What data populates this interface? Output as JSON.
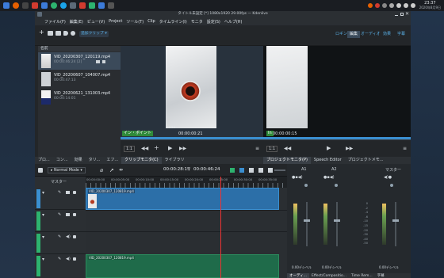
{
  "taskbar": {
    "clock_time": "23:37",
    "clock_date": "2020年8月9日",
    "app_icon_colors": [
      "#e66000",
      "#444444",
      "#d13b2f",
      "#3c7bd9",
      "#1aa3e8",
      "#d13b2f",
      "#2db36f"
    ]
  },
  "window": {
    "title": "タイトル未設定 [*] 1080x1920 29.00fps — Kdenlive"
  },
  "menu": [
    "ファイル(F)",
    "編集(E)",
    "ビュー(V)",
    "Project",
    "ツール(T)",
    "Clip",
    "タイムライン(I)",
    "モニタ",
    "設定(S)",
    "ヘルプ(H)"
  ],
  "toolbar": {
    "add_clip_label": "追加クリップ",
    "layouts": [
      "ロギング",
      "編集",
      "オーディオ",
      "効果",
      "字幕"
    ],
    "active_layout": "編集"
  },
  "bin": {
    "header": "名前",
    "clips": [
      {
        "name": "VID_20200307_120119.mp4",
        "duration": "00:00:46:24 [2]"
      },
      {
        "name": "VID_20200607_104007.mp4",
        "duration": "00:00:47:13"
      },
      {
        "name": "VID_20200621_131003.mp4",
        "duration": "00:00:14:01"
      }
    ]
  },
  "clip_monitor": {
    "in_point_label": "イン・ポイント",
    "timecode": "00:00:00:21",
    "vertical_timecode": "46:24"
  },
  "project_monitor": {
    "timecode": "00:00:00:15",
    "side_label": "In"
  },
  "monitor_controls": {
    "zoom_left": "1:1",
    "zoom_right": "1:1"
  },
  "tabs_left": [
    "プロ...",
    "コン...",
    "効果",
    "タリ...",
    "エフ...",
    "クリップモニタ(C)",
    "ライブラリ"
  ],
  "tabs_right": [
    "プロジェクトモニタ(P)",
    "Speech Editor",
    "プロジェクトメモ..."
  ],
  "timeline": {
    "mode": "Normal Mode",
    "position": "00:00:28:15",
    "duration": "00:00:46:24",
    "master_label": "マスター",
    "ruler_marks": [
      "00:00:00:00",
      "00:00:05:00",
      "00:00:10:00",
      "00:00:15:00",
      "00:00:20:00",
      "00:00:25:00",
      "00:00:30:00",
      "00:00:35:00"
    ],
    "video_clip_name": "VID_20200307_120819.mp4",
    "audio_clip_name": "VID_20200307_120819.mp4"
  },
  "mixer": {
    "master_label": "マスター",
    "channels": [
      "A1",
      "A2"
    ],
    "db_label": "0.00デシベル",
    "scale": [
      "0",
      "-2",
      "-4",
      "-6",
      "-10",
      "-15",
      "-20",
      "-30",
      "-40",
      "-50"
    ]
  },
  "tabs_bottom_right": [
    "オーディ...",
    "Effect/Compositio...",
    "Time Rem...",
    "字幕"
  ]
}
